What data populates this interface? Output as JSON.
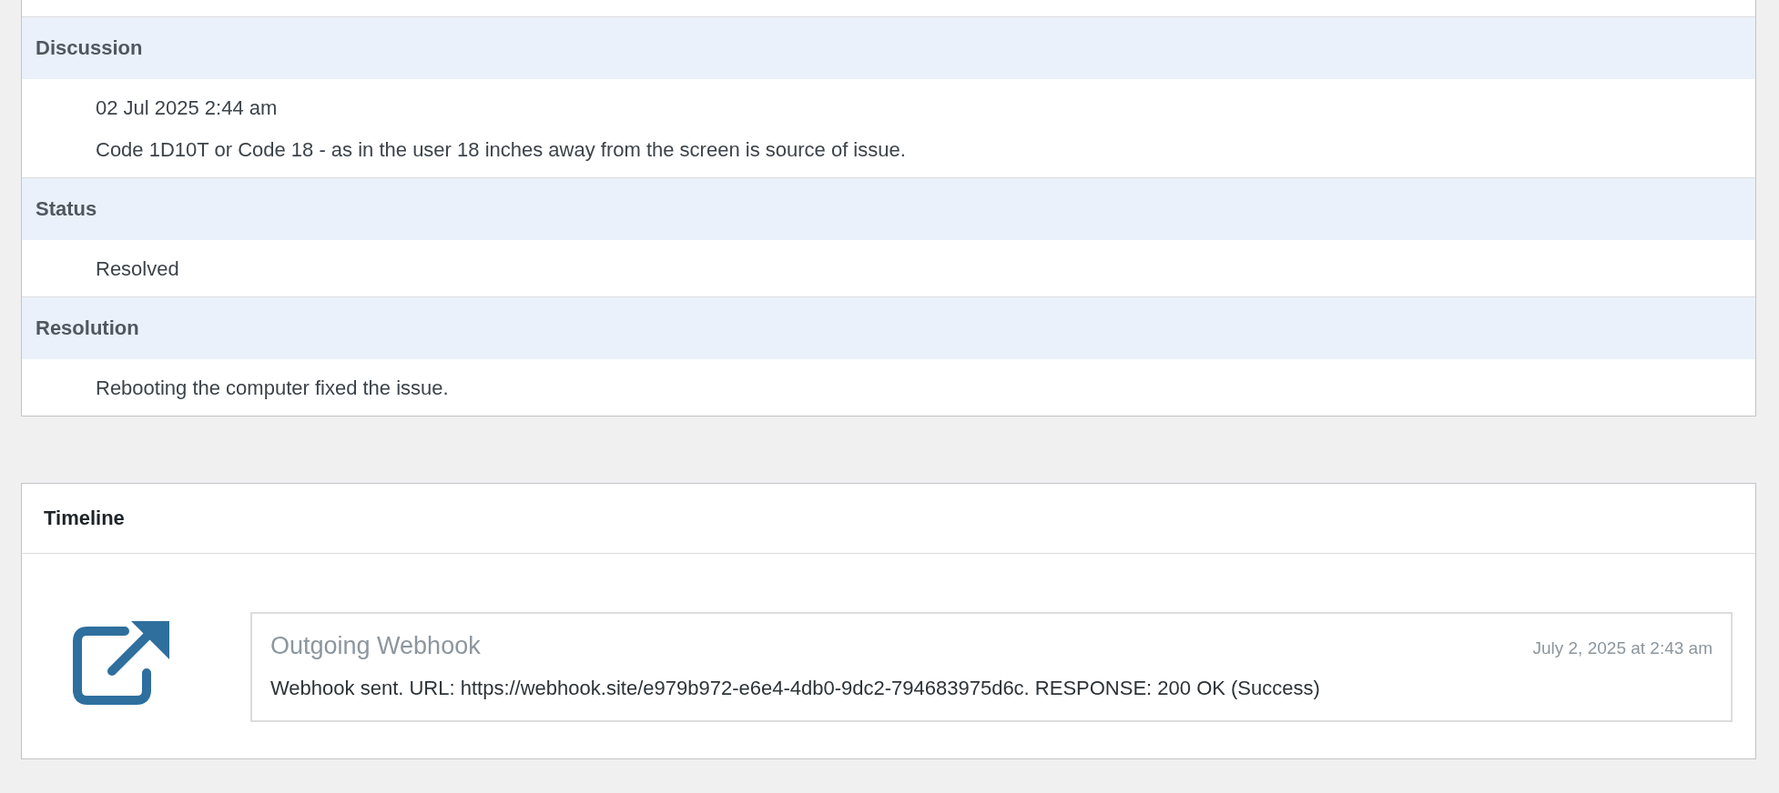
{
  "sections": [
    {
      "heading": "Discussion",
      "lines": [
        "02 Jul 2025 2:44 am",
        "Code 1D10T or Code 18 - as in the user 18 inches away from the screen is source of issue."
      ]
    },
    {
      "heading": "Status",
      "lines": [
        "Resolved"
      ]
    },
    {
      "heading": "Resolution",
      "lines": [
        "Rebooting the computer fixed the issue."
      ]
    }
  ],
  "timeline": {
    "title": "Timeline",
    "events": [
      {
        "kind": "webhook",
        "title": "Outgoing Webhook",
        "time": "July 2, 2025 at 2:43 am",
        "message": "Webhook sent. URL: https://webhook.site/e979b972-e6e4-4db0-9dc2-794683975d6c. RESPONSE: 200 OK (Success)"
      }
    ]
  }
}
